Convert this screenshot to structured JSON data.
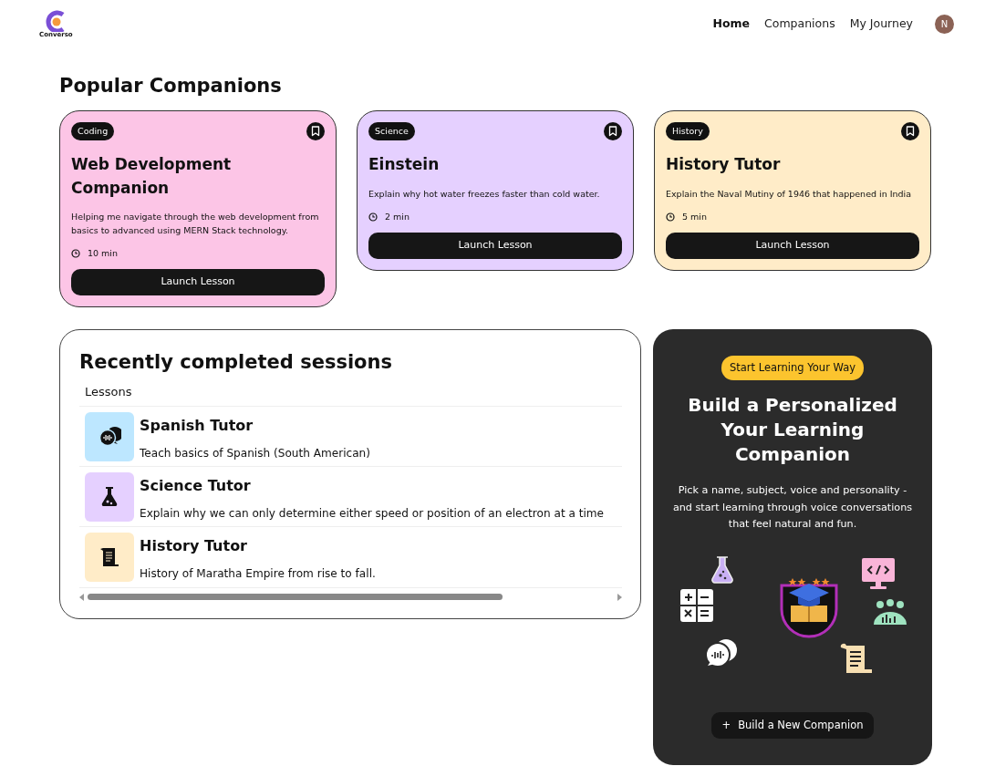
{
  "brand": {
    "name": "Converso"
  },
  "nav": [
    {
      "label": "Home",
      "selected": true
    },
    {
      "label": "Companions",
      "selected": false
    },
    {
      "label": "My Journey",
      "selected": false
    }
  ],
  "avatar": {
    "initial": "N"
  },
  "popular": {
    "title": "Popular Companions",
    "cards": [
      {
        "tag": "Coding",
        "title": "Web Development Companion",
        "description": "Helping me navigate through the web development from basics to advanced using MERN Stack technology.",
        "duration": "10 min",
        "button": "Launch Lesson",
        "color": "#fcc5e6"
      },
      {
        "tag": "Science",
        "title": "Einstein",
        "description": "Explain why hot water freezes faster than cold water.",
        "duration": "2 min",
        "button": "Launch Lesson",
        "color": "#e5d0ff"
      },
      {
        "tag": "History",
        "title": "History Tutor",
        "description": "Explain the Naval Mutiny of 1946 that happened in India",
        "duration": "5 min",
        "button": "Launch Lesson",
        "color": "#ffecc8"
      }
    ]
  },
  "recent": {
    "title": "Recently completed sessions",
    "column": "Lessons",
    "rows": [
      {
        "kind": "language",
        "color": "#bde7ff",
        "name": "Spanish Tutor",
        "description": "Teach basics of Spanish (South American)"
      },
      {
        "kind": "science",
        "color": "#e5d0ff",
        "name": "Science Tutor",
        "description": "Explain why we can only determine either speed or position of an electron at a time"
      },
      {
        "kind": "history",
        "color": "#ffecc8",
        "name": "History Tutor",
        "description": "History of Maratha Empire from rise to fall."
      }
    ]
  },
  "cta": {
    "badge": "Start Learning Your Way",
    "title": "Build a Personalized Your Learning Companion",
    "text": "Pick a name, subject, voice and personality - and start learning through voice conversations that feel natural and fun.",
    "button_icon": "+",
    "button": "Build a New Companion"
  }
}
